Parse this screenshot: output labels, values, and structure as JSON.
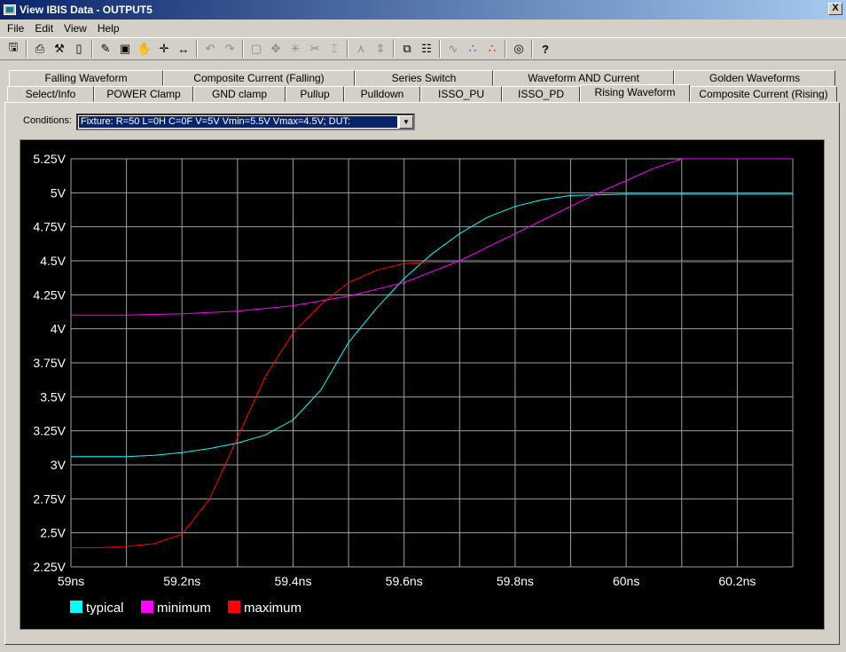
{
  "window": {
    "title": "View IBIS Data - OUTPUT5",
    "close_label": "X"
  },
  "menu": [
    {
      "label": "File"
    },
    {
      "label": "Edit"
    },
    {
      "label": "View"
    },
    {
      "label": "Help"
    }
  ],
  "tabs_row1": [
    {
      "label": "Falling Waveform"
    },
    {
      "label": "Composite Current (Falling)"
    },
    {
      "label": "Series Switch"
    },
    {
      "label": "Waveform AND Current"
    },
    {
      "label": "Golden Waveforms"
    }
  ],
  "tabs_row2": [
    {
      "label": "Select/Info"
    },
    {
      "label": "POWER Clamp"
    },
    {
      "label": "GND clamp"
    },
    {
      "label": "Pullup"
    },
    {
      "label": "Pulldown"
    },
    {
      "label": "ISSO_PU"
    },
    {
      "label": "ISSO_PD"
    },
    {
      "label": "Rising Waveform",
      "active": true
    },
    {
      "label": "Composite Current (Rising)"
    }
  ],
  "conditions": {
    "label": "Conditions:",
    "value": "Fixture: R=50 L=0H C=0F V=5V Vmin=5.5V Vmax=4.5V;  DUT:"
  },
  "chart_data": {
    "type": "line",
    "x_ticks": [
      "59ns",
      "59.2ns",
      "59.4ns",
      "59.6ns",
      "59.8ns",
      "60ns",
      "60.2ns"
    ],
    "y_ticks": [
      "5.25V",
      "5V",
      "4.75V",
      "4.5V",
      "4.25V",
      "4V",
      "3.75V",
      "3.5V",
      "3.25V",
      "3V",
      "2.75V",
      "2.5V",
      "2.25V"
    ],
    "xlim": [
      59.0,
      60.3
    ],
    "ylim": [
      2.25,
      5.25
    ],
    "grid": true,
    "legend": "bottom-left",
    "series": [
      {
        "name": "typical",
        "color": "#00ffff",
        "x": [
          59.0,
          59.05,
          59.1,
          59.15,
          59.2,
          59.25,
          59.3,
          59.35,
          59.4,
          59.45,
          59.5,
          59.55,
          59.6,
          59.65,
          59.7,
          59.75,
          59.8,
          59.85,
          59.9,
          60.0,
          60.1,
          60.2,
          60.3
        ],
        "y": [
          3.06,
          3.06,
          3.06,
          3.07,
          3.09,
          3.12,
          3.16,
          3.22,
          3.33,
          3.55,
          3.9,
          4.15,
          4.37,
          4.55,
          4.7,
          4.82,
          4.9,
          4.95,
          4.98,
          4.99,
          4.99,
          4.99,
          4.99
        ]
      },
      {
        "name": "minimum",
        "color": "#ff00ff",
        "x": [
          59.0,
          59.1,
          59.2,
          59.3,
          59.4,
          59.5,
          59.55,
          59.6,
          59.65,
          59.7,
          59.75,
          59.8,
          59.85,
          59.9,
          59.95,
          60.0,
          60.05,
          60.1,
          60.15,
          60.2,
          60.25,
          60.3
        ],
        "y": [
          4.1,
          4.1,
          4.11,
          4.13,
          4.17,
          4.24,
          4.29,
          4.34,
          4.42,
          4.5,
          4.6,
          4.7,
          4.8,
          4.9,
          5.0,
          5.09,
          5.18,
          5.25,
          5.25,
          5.25,
          5.25,
          5.25
        ]
      },
      {
        "name": "maximum",
        "color": "#ff0000",
        "x": [
          59.0,
          59.05,
          59.1,
          59.15,
          59.2,
          59.25,
          59.3,
          59.35,
          59.4,
          59.45,
          59.5,
          59.55,
          59.6,
          59.65,
          59.7,
          59.8,
          59.9,
          60.0,
          60.1,
          60.2,
          60.3
        ],
        "y": [
          2.39,
          2.39,
          2.4,
          2.42,
          2.49,
          2.75,
          3.2,
          3.65,
          3.97,
          4.18,
          4.34,
          4.43,
          4.48,
          4.49,
          4.49,
          4.49,
          4.49,
          4.49,
          4.49,
          4.49,
          4.49
        ]
      }
    ]
  }
}
